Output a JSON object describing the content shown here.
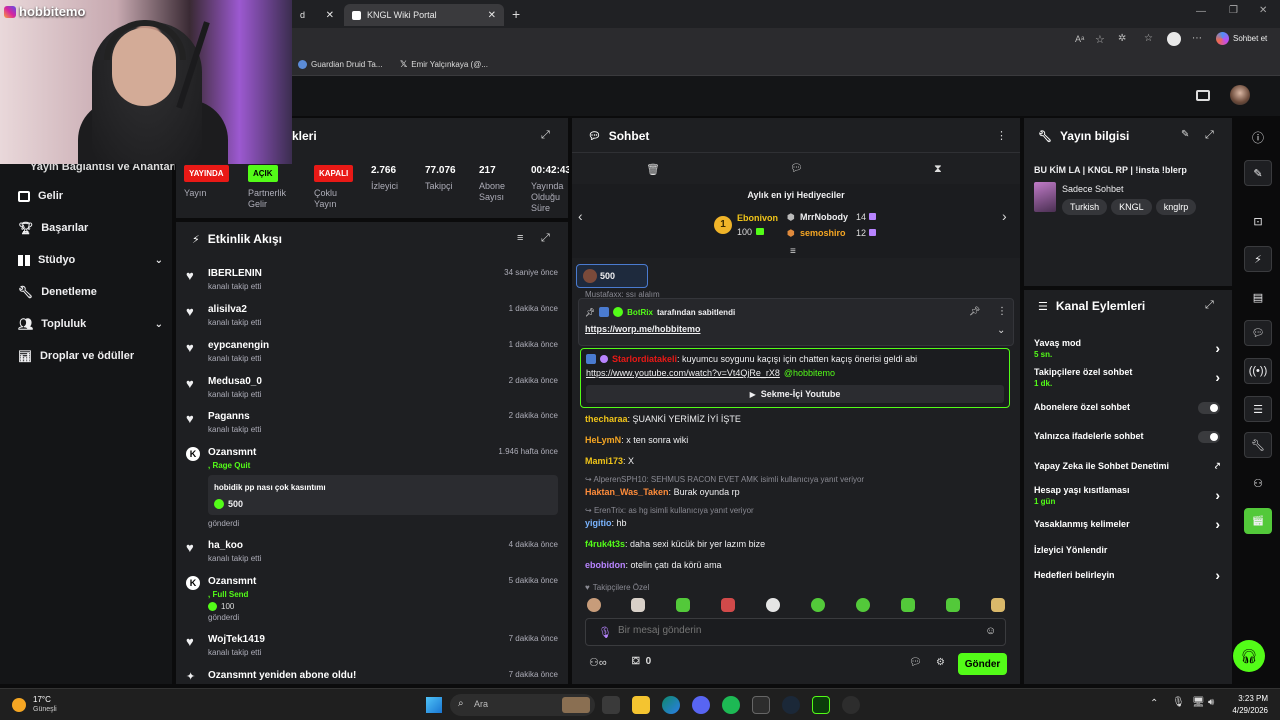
{
  "browser": {
    "tabs": [
      {
        "label": "d"
      },
      {
        "label": "KNGL Wiki Portal"
      }
    ],
    "address_right_label": "Sohbet et",
    "bookmarks": [
      {
        "label": "Guardian Druid Ta..."
      },
      {
        "label": "Emir Yalçınkaya (@..."
      }
    ]
  },
  "webcam": {
    "handle": "hobbitemo"
  },
  "left_nav": {
    "partial_item": "Yayın Bağlantısı ve Anahtarı",
    "items": [
      {
        "label": "Gelir",
        "icon": "table-icon"
      },
      {
        "label": "Başarılar",
        "icon": "trophy-icon"
      },
      {
        "label": "Stüdyo",
        "icon": "grid-icon",
        "expandable": true
      },
      {
        "label": "Denetleme",
        "icon": "wrench-icon"
      },
      {
        "label": "Topluluk",
        "icon": "people-icon",
        "expandable": true
      },
      {
        "label": "Droplar ve ödüller",
        "icon": "chart-icon"
      }
    ]
  },
  "stats_panel": {
    "title_partial": "kleri",
    "stats": [
      {
        "badge": "YAYINDA",
        "badge_color": "#e91916",
        "label": "Yayın"
      },
      {
        "badge": "AÇIK",
        "badge_color": "#53fc18",
        "label": "Partnerlik Gelir"
      },
      {
        "badge": "KAPALI",
        "badge_color": "#e91916",
        "label": "Çoklu Yayın"
      },
      {
        "value": "2.766",
        "label": "İzleyici"
      },
      {
        "value": "77.076",
        "label": "Takipçi"
      },
      {
        "value": "217",
        "label": "Abone Sayısı"
      },
      {
        "value": "00:42:43",
        "label": "Yayında Olduğu Süre"
      }
    ]
  },
  "activity_feed": {
    "title": "Etkinlik Akışı",
    "items": [
      {
        "name": "IBERLENIN",
        "sub": "kanalı takip etti",
        "time": "34 saniye önce",
        "icon": "heart-icon"
      },
      {
        "name": "alisilva2",
        "sub": "kanalı takip etti",
        "time": "1 dakika önce",
        "icon": "heart-icon"
      },
      {
        "name": "eypcanengin",
        "sub": "kanalı takip etti",
        "time": "1 dakika önce",
        "icon": "heart-icon"
      },
      {
        "name": "Medusa0_0",
        "sub": "kanalı takip etti",
        "time": "2 dakika önce",
        "icon": "heart-icon"
      },
      {
        "name": "Paganns",
        "sub": "kanalı takip etti",
        "time": "2 dakika önce",
        "icon": "heart-icon"
      },
      {
        "name": "Ozansmnt",
        "sub": ", Rage Quit",
        "time": "1.946 hafta önce",
        "icon": "kick-icon",
        "message": "hobidik pp nası çok kasıntımı",
        "amount": "500",
        "sent": "gönderdi"
      },
      {
        "name": "ha_koo",
        "sub": "kanalı takip etti",
        "time": "4 dakika önce",
        "icon": "heart-icon"
      },
      {
        "name": "Ozansmnt",
        "sub": ", Full Send",
        "time": "5 dakika önce",
        "icon": "kick-icon",
        "amount": "100",
        "sent": "gönderdi"
      },
      {
        "name": "WojTek1419",
        "sub": "kanalı takip etti",
        "time": "7 dakika önce",
        "icon": "heart-icon"
      },
      {
        "name": "Ozansmnt yeniden abone oldu!",
        "time": "7 dakika önce",
        "icon": "star-icon"
      }
    ]
  },
  "chat": {
    "title": "Sohbet",
    "gifters": {
      "title": "Aylık en iyi Hediyeciler",
      "first": {
        "name": "Ebonivon",
        "count": "100",
        "rank": "1"
      },
      "second": {
        "name": "MrrNobody",
        "count": "14"
      },
      "third": {
        "name": "semoshiro",
        "count": "12"
      }
    },
    "kicks_pill": "500",
    "cut_line": "Mustafaxx: ssı alalım",
    "pinned": {
      "by": "BotRix",
      "by_suffix": "tarafından sabitlendi",
      "link": "https://worp.me/hobbitemo"
    },
    "suggestion": {
      "user": "Starlordiatakeli",
      "text": ": kuyumcu soygunu kaçışı için chatten kaçış önerisi geldi abi",
      "link": "https://www.youtube.com/watch?v=Vt4QjRe_rX8",
      "mention": "@hobbitemo",
      "button": "Sekme-İçi Youtube"
    },
    "messages": [
      {
        "user": "thecharaa",
        "color": "#f0c419",
        "text": "ŞUANKİ YERİMİZ İYİ İŞTE"
      },
      {
        "user": "HeLymN",
        "color": "#f5a623",
        "text": "x ten sonra wiki"
      },
      {
        "user": "Mami173",
        "color": "#f0c419",
        "text": "X"
      },
      {
        "reply": "AlperenSPH10: SEHMUS RACON EVET AMK isimli kullanıcıya yanıt veriyor",
        "user": "Haktan_Was_Taken",
        "color": "#ff8c3a",
        "text": "Burak oyunda rp"
      },
      {
        "reply": "ErenTrix: as hg isimli kullanıcıya yanıt veriyor",
        "user": "yigitio",
        "color": "#7ab4ff",
        "text": "hb"
      },
      {
        "user": "f4ruk4t3s",
        "color": "#53fc18",
        "text": "daha sexi kücük bir yer lazım bize"
      },
      {
        "user": "ebobidon",
        "color": "#b884ff",
        "text": "otelin çatı da körü ama"
      }
    ],
    "followers_only": "Takipçilere Özel",
    "input_placeholder": "Bir mesaj gönderin",
    "kick_count": "0",
    "send_button": "Gönder"
  },
  "stream_info": {
    "title": "Yayın bilgisi",
    "stream_title": "BU KİM LA | KNGL RP | !insta !blerp",
    "category": "Sadece Sohbet",
    "tags": [
      "Turkish",
      "KNGL",
      "knglrp"
    ]
  },
  "channel_actions": {
    "title": "Kanal Eylemleri",
    "items": [
      {
        "label": "Yavaş mod",
        "sub": "5 sn.",
        "control": "chevron"
      },
      {
        "label": "Takipçilere özel sohbet",
        "sub": "1 dk.",
        "control": "chevron"
      },
      {
        "label": "Abonelere özel sohbet",
        "control": "toggle"
      },
      {
        "label": "Yalnızca ifadelerle sohbet",
        "control": "toggle"
      },
      {
        "label": "Yapay Zeka ile Sohbet Denetimi",
        "control": "external"
      },
      {
        "label": "Hesap yaşı kısıtlaması",
        "sub": "1 gün",
        "control": "chevron"
      },
      {
        "label": "Yasaklanmış kelimeler",
        "control": "chevron"
      },
      {
        "label": "İzleyici Yönlendir",
        "control": "none"
      },
      {
        "label": "Hedefleri belirleyin",
        "control": "chevron"
      }
    ]
  },
  "taskbar": {
    "weather_temp": "17°C",
    "weather_label": "Güneşli",
    "search_placeholder": "Ara",
    "time": "3:23 PM",
    "date": "4/29/2026"
  },
  "colors": {
    "kick_green": "#53fc18",
    "live_red": "#e91916",
    "panel_bg": "#1e1f22"
  }
}
